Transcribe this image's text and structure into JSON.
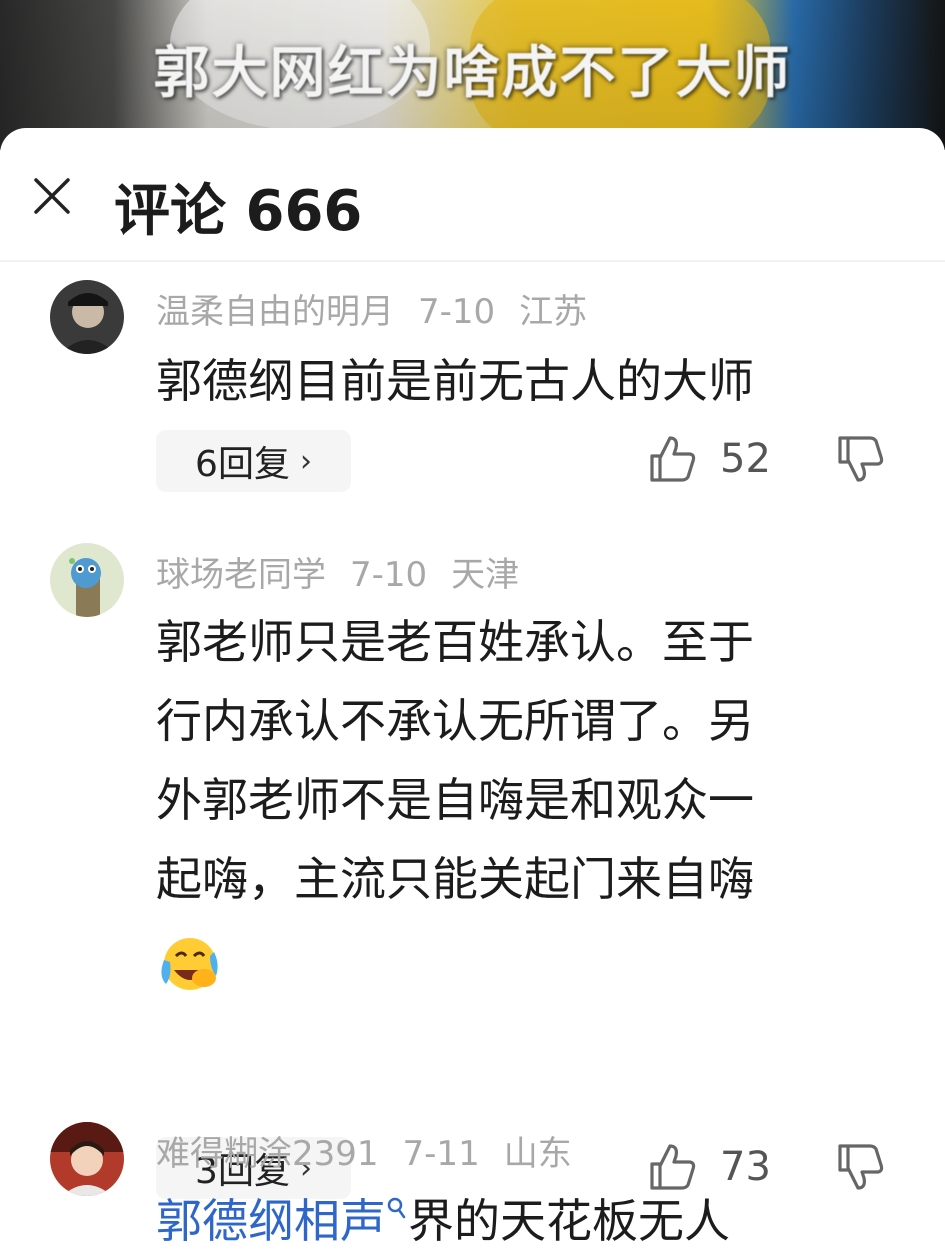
{
  "video": {
    "title": "郭大网红为啥成不了大师"
  },
  "header": {
    "title": "评论 666"
  },
  "comments": [
    {
      "user": "温柔自由的明月",
      "date": "7-10",
      "location": "江苏",
      "text": "郭德纲目前是前无古人的大师",
      "replies": "6回复",
      "likes": "52"
    },
    {
      "user": "球场老同学",
      "date": "7-10",
      "location": "天津",
      "text_lines": [
        "郭老师只是老百姓承认。至于",
        "行内承认不承认无所谓了。另",
        "外郭老师不是自嗨是和观众一",
        "起嗨，主流只能关起门来自嗨"
      ],
      "emoji": "laughing-crying-emoji",
      "replies": "3回复",
      "likes": "73"
    },
    {
      "user": "难得糊涂2391",
      "date": "7-11",
      "location": "山东",
      "link_text": "郭德纲相声",
      "text_after": "界的天花板无人"
    }
  ],
  "colors": {
    "link": "#2e67c9",
    "meta": "#a8a8a8",
    "text": "#1c1c1c",
    "chip_bg": "#f5f5f5"
  }
}
